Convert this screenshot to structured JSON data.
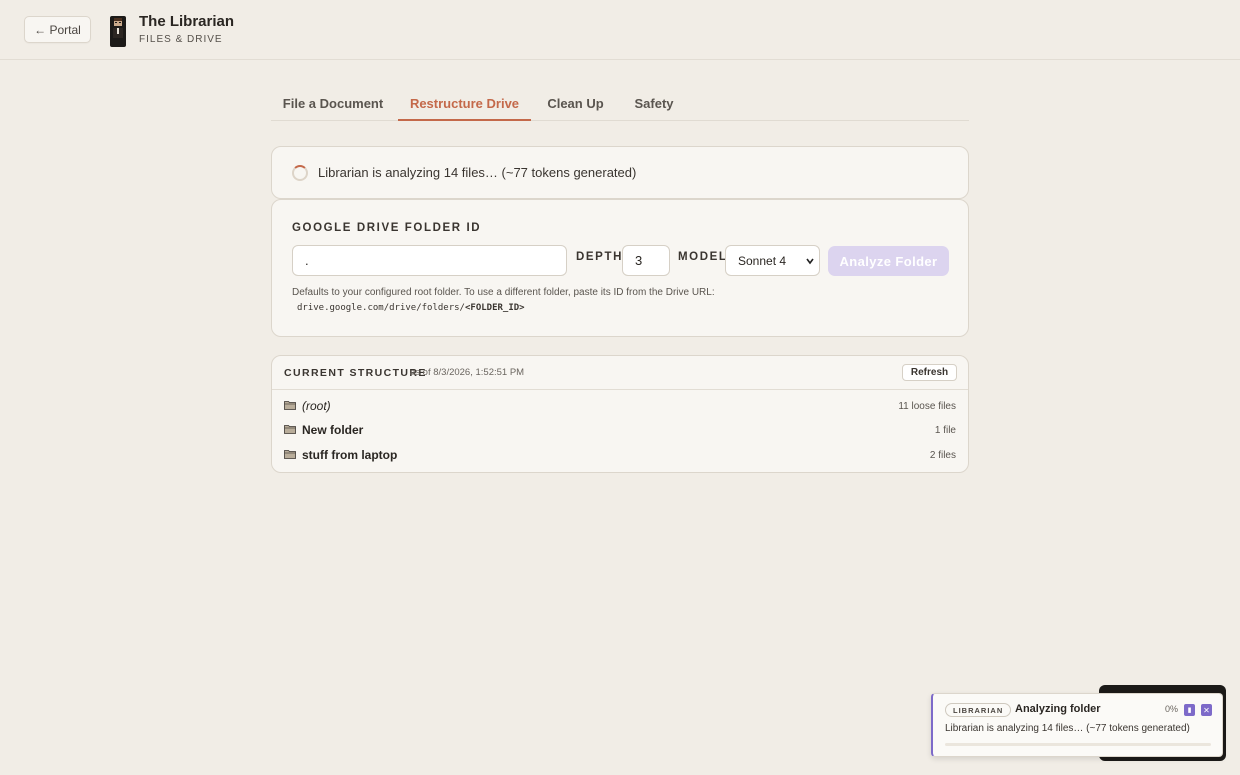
{
  "header": {
    "portal_label": "← Portal",
    "title": "The Librarian",
    "subtitle": "FILES & DRIVE"
  },
  "tabs": [
    {
      "label": "File a Document",
      "active": false
    },
    {
      "label": "Restructure Drive",
      "active": true
    },
    {
      "label": "Clean Up",
      "active": false
    },
    {
      "label": "Safety",
      "active": false
    }
  ],
  "status": {
    "text": "Librarian is analyzing 14 files… (~77 tokens generated)"
  },
  "form": {
    "folder_id_label": "GOOGLE DRIVE FOLDER ID",
    "folder_id_value": ".",
    "depth_label": "DEPTH",
    "depth_value": "3",
    "model_label": "MODEL",
    "model_value": "Sonnet 4",
    "analyze_label": "Analyze Folder",
    "help_text": "Defaults to your configured root folder. To use a different folder, paste its ID from the Drive URL:",
    "help_path_prefix": "drive.google.com/drive/folders/",
    "help_path_placeholder": "<FOLDER_ID>"
  },
  "structure": {
    "title": "CURRENT STRUCTURE",
    "timestamp": "as of 8/3/2026, 1:52:51 PM",
    "refresh_label": "Refresh",
    "rows": [
      {
        "name": "(root)",
        "count": "11 loose files",
        "style": "ital"
      },
      {
        "name": "New folder",
        "count": "1 file",
        "style": "bold"
      },
      {
        "name": "stuff from laptop",
        "count": "2 files",
        "style": "bold"
      }
    ]
  },
  "panel": {
    "badge": "LIBRARIAN",
    "title": "Analyzing folder",
    "percent": "0%",
    "progress": 0,
    "message": "Librarian is analyzing 14 files… (~77 tokens generated)"
  },
  "colors": {
    "accent": "#c4694a",
    "panel_accent": "#7d6ac9",
    "background": "#f1ede6"
  }
}
